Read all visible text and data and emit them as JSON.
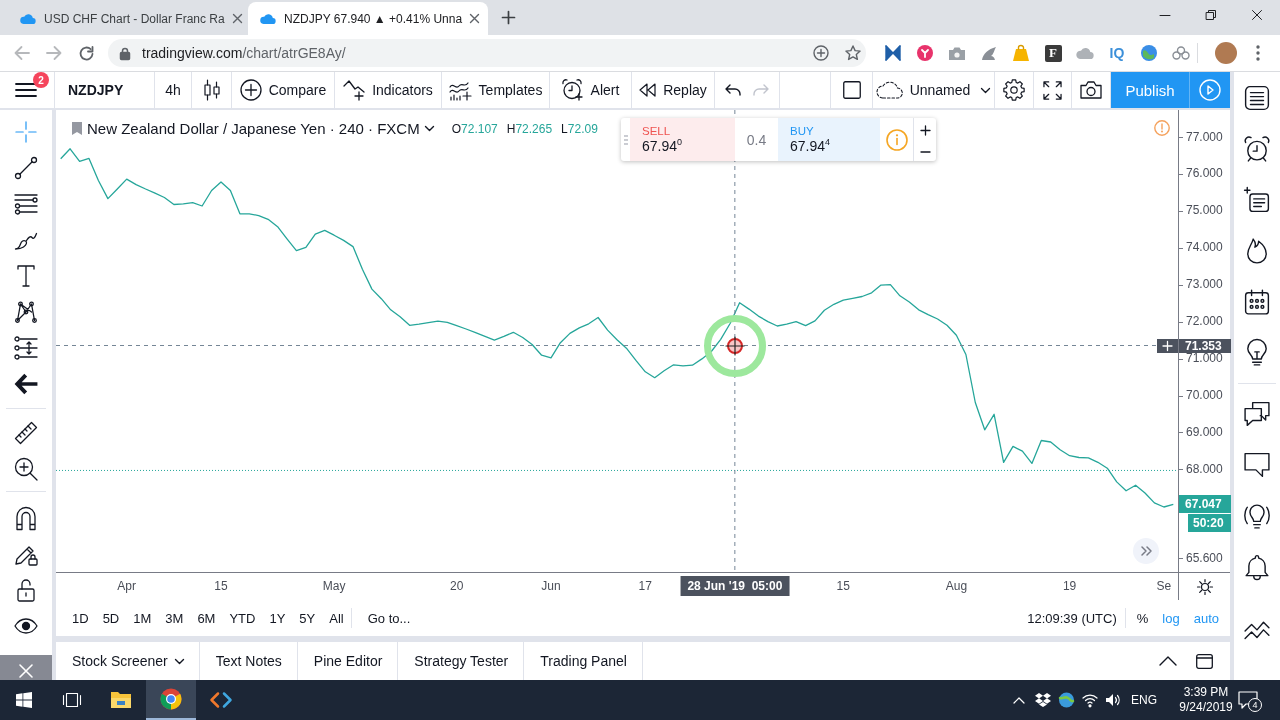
{
  "browser": {
    "tabs": [
      {
        "title": "USD CHF Chart - Dollar Franc Ra",
        "selected": false
      },
      {
        "title": "NZDJPY 67.940 ▲ +0.41% Unna",
        "selected": true
      }
    ],
    "url": {
      "host": "tradingview.com",
      "path": "/chart/atrGE8Ay/"
    },
    "extension_labels": [
      "F",
      "IQ"
    ]
  },
  "toolbar": {
    "menu_badge": "2",
    "symbol": "NZDJPY",
    "interval": "4h",
    "compare": "Compare",
    "indicators": "Indicators",
    "templates": "Templates",
    "alert": "Alert",
    "replay": "Replay",
    "undo": {
      "disabled": false
    },
    "redo": {
      "disabled": true
    },
    "layout_name": "Unnamed",
    "publish": "Publish"
  },
  "drawing_tools": [
    {
      "selected": true
    },
    {
      "selected": false
    },
    {
      "selected": false
    },
    {
      "selected": false
    },
    {
      "selected": false
    },
    {
      "selected": false
    },
    {
      "selected": false
    },
    {
      "selected": false
    },
    {
      "selected": false
    },
    {
      "selected": false
    }
  ],
  "chart": {
    "symbol_title": "New Zealand Dollar / Japanese Yen · 240 · FXCM",
    "ohlc": [
      {
        "label": "O",
        "value": "72.107"
      },
      {
        "label": "H",
        "value": "72.265"
      },
      {
        "label": "L",
        "value": "72.09"
      }
    ],
    "trade_widget": {
      "sell_label": "SELL",
      "sell_price": "67.94$^{0}$",
      "spread": "0.4",
      "buy_label": "BUY",
      "buy_price": "67.94$^{4}$"
    },
    "last_price": {
      "label": "67.047",
      "countdown": "50:20"
    },
    "crosshair": {
      "time_label": "28 Jun '19  05:00"
    },
    "chart_data": {
      "type": "line",
      "categories": [
        null,
        null,
        null,
        null,
        null,
        null,
        null,
        "Apr",
        null,
        null,
        null,
        null,
        null,
        null,
        null,
        null,
        null,
        "15",
        null,
        null,
        null,
        null,
        null,
        null,
        null,
        null,
        null,
        null,
        null,
        "May",
        null,
        null,
        null,
        null,
        null,
        null,
        null,
        null,
        null,
        null,
        null,
        null,
        "20",
        null,
        null,
        null,
        null,
        null,
        null,
        null,
        null,
        null,
        "Jun",
        null,
        null,
        null,
        null,
        null,
        null,
        null,
        null,
        null,
        "17",
        null,
        null,
        null,
        null,
        null,
        null,
        null,
        null,
        null,
        null,
        null,
        null,
        null,
        null,
        null,
        null,
        null,
        null,
        null,
        null,
        "15",
        null,
        null,
        null,
        null,
        null,
        null,
        null,
        null,
        null,
        null,
        null,
        "Aug",
        null,
        null,
        null,
        null,
        null,
        null,
        null,
        null,
        null,
        null,
        null,
        "19",
        null,
        null,
        null,
        null,
        null,
        null,
        null,
        null,
        null,
        "Se",
        null
      ],
      "series": [
        {
          "color": "#26a69a",
          "values": [
            76.41,
            76.68,
            76.34,
            76.42,
            75.82,
            75.33,
            75.59,
            75.86,
            75.71,
            75.59,
            75.48,
            75.36,
            75.17,
            75.19,
            75.22,
            75.13,
            75.55,
            75.78,
            75.55,
            74.92,
            74.92,
            74.87,
            74.77,
            74.57,
            74.24,
            73.92,
            74.01,
            74.37,
            74.47,
            74.34,
            74.2,
            74.03,
            73.42,
            72.88,
            72.62,
            72.32,
            72.13,
            71.9,
            71.93,
            71.97,
            72.01,
            71.98,
            71.89,
            71.8,
            71.7,
            71.6,
            71.5,
            71.6,
            71.71,
            71.57,
            71.38,
            71.09,
            71.02,
            71.43,
            71.68,
            71.83,
            71.94,
            72.11,
            71.77,
            71.51,
            71.28,
            70.95,
            70.64,
            70.48,
            70.67,
            70.83,
            70.8,
            70.82,
            70.99,
            71.19,
            71.52,
            71.95,
            72.51,
            72.34,
            72.15,
            72.0,
            71.88,
            71.93,
            72.0,
            71.89,
            72.02,
            72.31,
            72.47,
            72.58,
            72.63,
            72.68,
            72.78,
            72.99,
            73.0,
            72.7,
            72.53,
            72.32,
            72.19,
            72.07,
            71.9,
            71.63,
            71.11,
            69.81,
            69.07,
            69.49,
            68.19,
            68.62,
            68.49,
            68.16,
            68.78,
            68.74,
            68.53,
            68.37,
            68.32,
            68.31,
            68.19,
            68.03,
            67.66,
            67.42,
            67.57,
            67.36,
            67.09,
            66.98,
            67.05
          ]
        }
      ],
      "ylim": [
        65.22,
        77.73
      ],
      "yticks": [
        {
          "value": 77,
          "label": "77.000"
        },
        {
          "value": 76,
          "label": "76.000"
        },
        {
          "value": 75,
          "label": "75.000"
        },
        {
          "value": 74,
          "label": "74.000"
        },
        {
          "value": 73,
          "label": "73.000"
        },
        {
          "value": 72,
          "label": "72.000"
        },
        {
          "value": 71,
          "label": "71.000"
        },
        {
          "value": 70,
          "label": "70.000"
        },
        {
          "value": 69,
          "label": "69.000"
        },
        {
          "value": 68,
          "label": "68.000"
        },
        {
          "value": 65.6,
          "label": "65.600"
        }
      ],
      "ref_lines": [
        {
          "axis": "y",
          "value": 67.97
        },
        {
          "axis": "y",
          "value": 71.353,
          "label": "71.353"
        }
      ]
    }
  },
  "range_bar": {
    "ranges": [
      "1D",
      "5D",
      "1M",
      "3M",
      "6M",
      "YTD",
      "1Y",
      "5Y",
      "All"
    ],
    "goto": "Go to...",
    "clock": "12:09:39 (UTC)",
    "scale_options": [
      {
        "label": "%",
        "selected": false
      },
      {
        "label": "log",
        "selected": true
      },
      {
        "label": "auto",
        "selected": true
      }
    ]
  },
  "bottom_panel": {
    "tabs": [
      {
        "label": "Stock Screener",
        "has_menu": true
      },
      {
        "label": "Text Notes",
        "has_menu": false
      },
      {
        "label": "Pine Editor",
        "has_menu": false
      },
      {
        "label": "Strategy Tester",
        "has_menu": false
      },
      {
        "label": "Trading Panel",
        "has_menu": false
      }
    ]
  },
  "taskbar": {
    "apps": [
      {
        "selected": false
      },
      {
        "selected": true
      },
      {
        "selected": false
      }
    ],
    "language": "ENG",
    "time": "3:39 PM",
    "date": "9/24/2019",
    "notification_count": "4"
  }
}
